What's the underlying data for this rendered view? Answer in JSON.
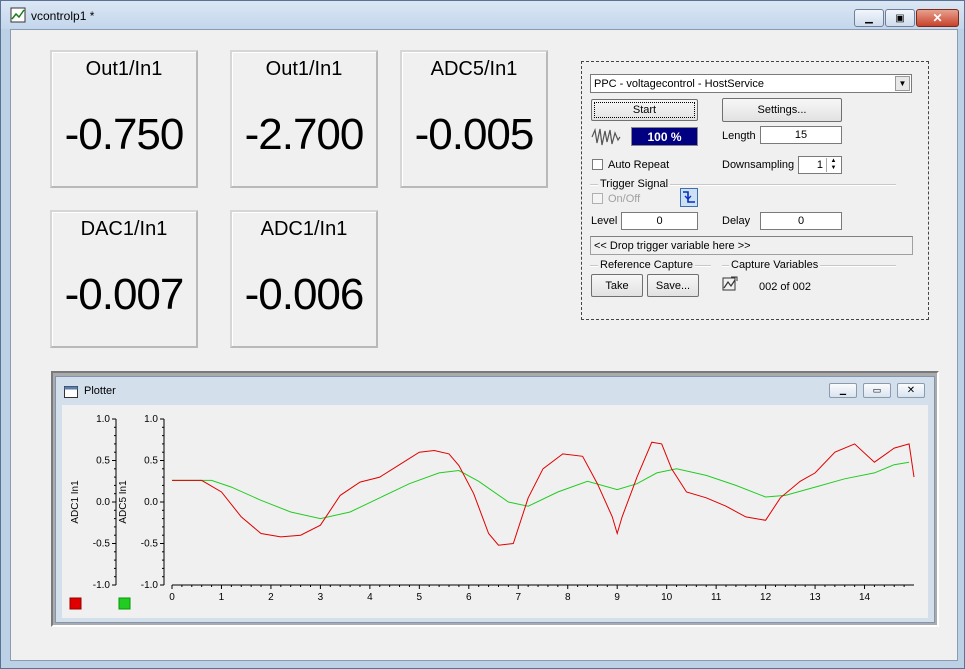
{
  "window": {
    "title": "vcontrolp1 *"
  },
  "tiles": [
    {
      "label": "Out1/In1",
      "value": "-0.750"
    },
    {
      "label": "Out1/In1",
      "value": "-2.700"
    },
    {
      "label": "ADC5/In1",
      "value": "-0.005"
    },
    {
      "label": "DAC1/In1",
      "value": "-0.007"
    },
    {
      "label": "ADC1/In1",
      "value": "-0.006"
    }
  ],
  "scope": {
    "target": "PPC - voltagecontrol - HostService",
    "start_label": "Start",
    "settings_label": "Settings...",
    "progress": "100 %",
    "progress_fraction": 1.0,
    "length_label": "Length",
    "length_value": "15",
    "auto_repeat_label": "Auto Repeat",
    "downsampling_label": "Downsampling",
    "downsampling_value": "1",
    "trigger_group": "Trigger Signal",
    "onoff_label": "On/Off",
    "level_label": "Level",
    "level_value": "0",
    "delay_label": "Delay",
    "delay_value": "0",
    "drop_trigger": "<< Drop trigger variable here >>",
    "reference_group": "Reference Capture",
    "take_label": "Take",
    "save_label": "Save...",
    "capture_group": "Capture Variables",
    "capture_count": "002 of 002"
  },
  "plotter": {
    "title": "Plotter",
    "axes_labels": [
      "ADC1 In1",
      "ADC5 In1"
    ],
    "y_ticks": [
      "1.0",
      "0.5",
      "0.0",
      "-0.5",
      "-1.0"
    ],
    "x_ticks": [
      "0",
      "1",
      "2",
      "3",
      "4",
      "5",
      "6",
      "7",
      "8",
      "9",
      "10",
      "11",
      "12",
      "13",
      "14"
    ],
    "colors": {
      "red": "#e00000",
      "green": "#22cc22"
    }
  },
  "chart_data": {
    "type": "line",
    "xlim": [
      0,
      15
    ],
    "ylim": [
      -1.0,
      1.0
    ],
    "series": [
      {
        "name": "ADC1 In1",
        "color": "#e00000",
        "x": [
          0,
          0.6,
          1,
          1.4,
          1.8,
          2.2,
          2.6,
          3.0,
          3.4,
          3.8,
          4.2,
          4.6,
          5.0,
          5.3,
          5.6,
          5.8,
          6.1,
          6.4,
          6.6,
          6.9,
          7.2,
          7.5,
          7.9,
          8.3,
          8.6,
          8.9,
          9.0,
          9.1,
          9.4,
          9.7,
          9.9,
          10.1,
          10.4,
          10.8,
          11.2,
          11.6,
          12.0,
          12.3,
          12.7,
          13.0,
          13.4,
          13.8,
          14.2,
          14.6,
          14.9,
          15.0
        ],
        "values": [
          0.26,
          0.26,
          0.12,
          -0.18,
          -0.38,
          -0.42,
          -0.4,
          -0.28,
          0.08,
          0.24,
          0.3,
          0.45,
          0.6,
          0.62,
          0.58,
          0.44,
          0.1,
          -0.38,
          -0.52,
          -0.5,
          0.05,
          0.4,
          0.58,
          0.55,
          0.22,
          -0.18,
          -0.38,
          -0.18,
          0.3,
          0.72,
          0.7,
          0.4,
          0.12,
          0.05,
          -0.05,
          -0.18,
          -0.22,
          0.05,
          0.25,
          0.35,
          0.6,
          0.7,
          0.48,
          0.65,
          0.7,
          0.3
        ]
      },
      {
        "name": "ADC5 In1",
        "color": "#22cc22",
        "x": [
          0,
          0.8,
          1.2,
          1.8,
          2.4,
          3.0,
          3.6,
          4.2,
          4.8,
          5.4,
          5.8,
          6.2,
          6.8,
          7.2,
          7.8,
          8.4,
          9.0,
          9.4,
          9.8,
          10.2,
          10.8,
          11.4,
          12.0,
          12.4,
          13.0,
          13.6,
          14.2,
          14.6,
          14.9
        ],
        "values": [
          0.26,
          0.26,
          0.18,
          0.02,
          -0.12,
          -0.2,
          -0.12,
          0.05,
          0.22,
          0.35,
          0.38,
          0.25,
          0.0,
          -0.05,
          0.12,
          0.25,
          0.15,
          0.22,
          0.35,
          0.4,
          0.32,
          0.2,
          0.06,
          0.08,
          0.18,
          0.28,
          0.35,
          0.45,
          0.48
        ]
      }
    ]
  }
}
